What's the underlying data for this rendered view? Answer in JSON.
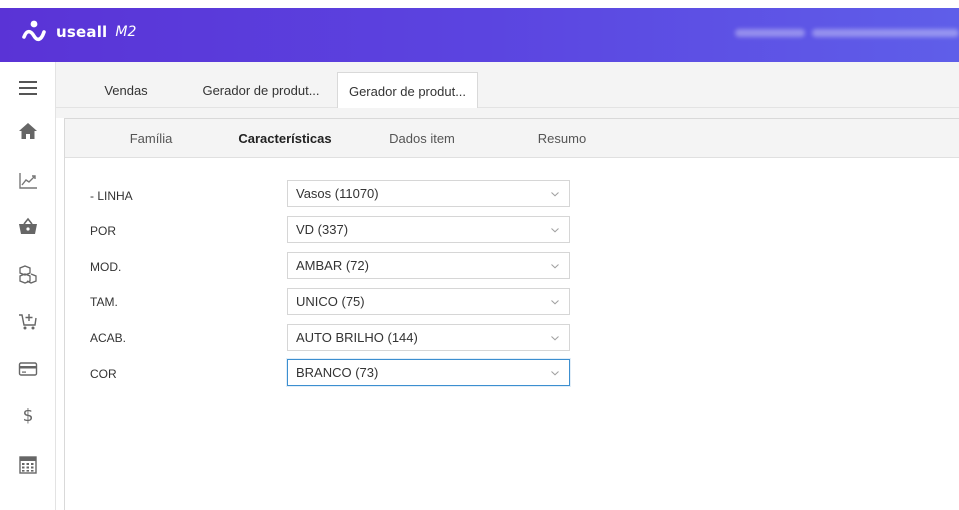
{
  "header": {
    "brand": "useall",
    "product": "M2",
    "colors": {
      "gradient_start": "#5a33d6",
      "gradient_end": "#5f5ee9"
    }
  },
  "sidebar": {
    "items": [
      {
        "icon": "menu-icon"
      },
      {
        "icon": "home-icon"
      },
      {
        "icon": "chart-line-icon"
      },
      {
        "icon": "basket-icon"
      },
      {
        "icon": "boxes-icon"
      },
      {
        "icon": "cart-add-icon"
      },
      {
        "icon": "credit-card-icon"
      },
      {
        "icon": "dollar-icon"
      },
      {
        "icon": "calculator-icon"
      }
    ]
  },
  "tabs": [
    {
      "label": "Vendas"
    },
    {
      "label": "Gerador de produt..."
    },
    {
      "label": "Gerador de produt..."
    }
  ],
  "steps": [
    {
      "label": "Família"
    },
    {
      "label": "Características"
    },
    {
      "label": "Dados item"
    },
    {
      "label": "Resumo"
    }
  ],
  "form": {
    "rows": [
      {
        "label": "- LINHA",
        "value": "Vasos (11070)"
      },
      {
        "label": "POR",
        "value": "VD (337)"
      },
      {
        "label": "MOD.",
        "value": "AMBAR (72)"
      },
      {
        "label": "TAM.",
        "value": "UNICO (75)"
      },
      {
        "label": "ACAB.",
        "value": "AUTO BRILHO (144)"
      },
      {
        "label": "COR",
        "value": "BRANCO (73)"
      }
    ]
  },
  "accent_color": "#4f46e5",
  "focus_color": "#3c8fd0"
}
